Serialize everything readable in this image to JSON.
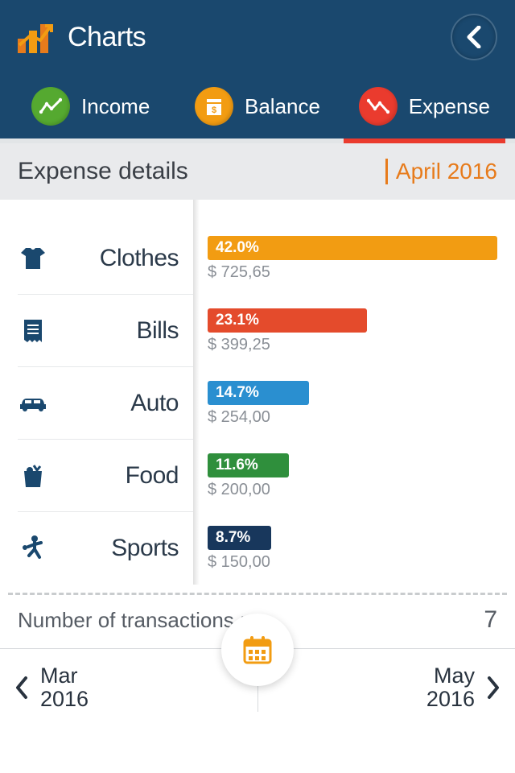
{
  "header": {
    "title": "Charts"
  },
  "tabs": {
    "income": {
      "label": "Income"
    },
    "balance": {
      "label": "Balance"
    },
    "expense": {
      "label": "Expense"
    }
  },
  "subheader": {
    "title": "Expense details",
    "period": "April 2016"
  },
  "categories": [
    {
      "name": "Clothes",
      "pct": "42.0%",
      "amount": "$ 725,65",
      "color": "#f29c12",
      "width": 100
    },
    {
      "name": "Bills",
      "pct": "23.1%",
      "amount": "$ 399,25",
      "color": "#e44b2c",
      "width": 55
    },
    {
      "name": "Auto",
      "pct": "14.7%",
      "amount": "$ 254,00",
      "color": "#2a8fd0",
      "width": 35
    },
    {
      "name": "Food",
      "pct": "11.6%",
      "amount": "$ 200,00",
      "color": "#2f8f3c",
      "width": 28
    },
    {
      "name": "Sports",
      "pct": "8.7%",
      "amount": "$ 150,00",
      "color": "#18375c",
      "width": 22
    }
  ],
  "transactions": {
    "label": "Number of transactions :",
    "count": "7"
  },
  "nav": {
    "prev": {
      "month": "Mar",
      "year": "2016"
    },
    "next": {
      "month": "May",
      "year": "2016"
    }
  },
  "chart_data": {
    "type": "bar",
    "title": "Expense details — April 2016",
    "orientation": "horizontal",
    "categories": [
      "Clothes",
      "Bills",
      "Auto",
      "Food",
      "Sports"
    ],
    "values_pct": [
      42.0,
      23.1,
      14.7,
      11.6,
      8.7
    ],
    "values_amount": [
      725.65,
      399.25,
      254.0,
      200.0,
      150.0
    ],
    "currency": "$",
    "colors": [
      "#f29c12",
      "#e44b2c",
      "#2a8fd0",
      "#2f8f3c",
      "#18375c"
    ],
    "xlabel": "",
    "ylabel": "",
    "xlim": [
      0,
      100
    ]
  }
}
